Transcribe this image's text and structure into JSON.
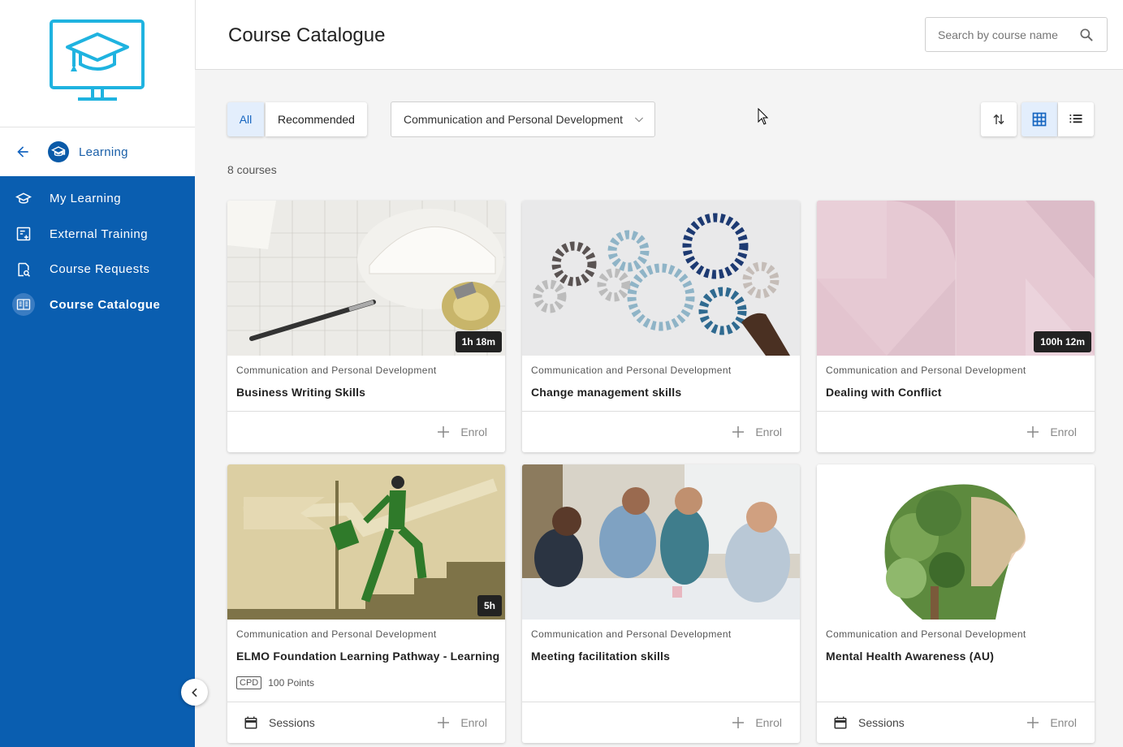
{
  "sidebar": {
    "back_label": "Learning",
    "items": [
      {
        "label": "My Learning",
        "icon": "graduation-cap-icon"
      },
      {
        "label": "External Training",
        "icon": "external-training-icon"
      },
      {
        "label": "Course Requests",
        "icon": "course-request-icon"
      },
      {
        "label": "Course Catalogue",
        "icon": "book-open-icon",
        "active": true
      }
    ]
  },
  "header": {
    "title": "Course Catalogue",
    "search_placeholder": "Search by course name"
  },
  "filters": {
    "tab_all": "All",
    "tab_recommended": "Recommended",
    "category_selected": "Communication and Personal Development"
  },
  "results": {
    "count_label": "8 courses"
  },
  "courses": [
    {
      "category": "Communication and Personal Development",
      "title": "Business Writing Skills",
      "duration": "1h 18m",
      "enrol": "Enrol"
    },
    {
      "category": "Communication and Personal Development",
      "title": "Change management skills",
      "enrol": "Enrol"
    },
    {
      "category": "Communication and Personal Development",
      "title": "Dealing with Conflict",
      "duration": "100h 12m",
      "enrol": "Enrol"
    },
    {
      "category": "Communication and Personal Development",
      "title": "ELMO Foundation Learning Pathway - Learning",
      "duration": "5h",
      "cpd_badge": "CPD",
      "cpd_points": "100 Points",
      "sessions": "Sessions",
      "enrol": "Enrol"
    },
    {
      "category": "Communication and Personal Development",
      "title": "Meeting facilitation skills",
      "enrol": "Enrol"
    },
    {
      "category": "Communication and Personal Development",
      "title": "Mental Health Awareness (AU)",
      "sessions": "Sessions",
      "enrol": "Enrol"
    }
  ],
  "colors": {
    "primary": "#0a5eb0",
    "accent": "#1565c0",
    "logo": "#1fb3e0"
  }
}
